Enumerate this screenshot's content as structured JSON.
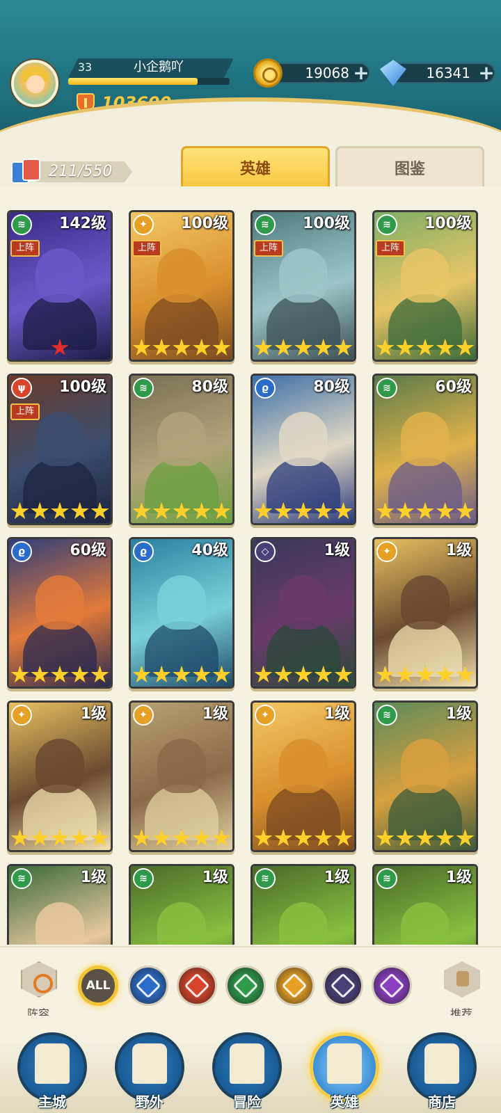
{
  "player": {
    "level": "33",
    "name": "小企鹅吖",
    "xp_fraction": 0.8,
    "power": "103600"
  },
  "resources": {
    "gold": "19068",
    "gems": "16341",
    "plus": "+"
  },
  "heroes_count": "211/550",
  "tabs": {
    "heroes": "英雄",
    "codex": "图鉴"
  },
  "deploy_label": "上阵",
  "element_colors": {
    "nature": "#2e9a4a",
    "light": "#e6a025",
    "fire": "#d8452a",
    "water": "#2a6cc8",
    "void": "#4b3f78",
    "arcane": "#8a3fc0"
  },
  "hero_cards": [
    {
      "element": "nature",
      "level": "142级",
      "deployed": true,
      "stars": 0,
      "red_star": true,
      "art": [
        "#3a2a86",
        "#6b58c8",
        "#1c1c44"
      ]
    },
    {
      "element": "light",
      "level": "100级",
      "deployed": true,
      "stars": 5,
      "red_star": false,
      "art": [
        "#f3c764",
        "#d9902e",
        "#7a4a20"
      ]
    },
    {
      "element": "nature",
      "level": "100级",
      "deployed": true,
      "stars": 5,
      "red_star": false,
      "art": [
        "#4d7a7e",
        "#9cc5c9",
        "#3b4f55"
      ]
    },
    {
      "element": "nature",
      "level": "100级",
      "deployed": true,
      "stars": 5,
      "red_star": false,
      "art": [
        "#7fae66",
        "#e8c567",
        "#3a6a3a"
      ]
    },
    {
      "element": "fire",
      "level": "100级",
      "deployed": true,
      "stars": 5,
      "red_star": false,
      "art": [
        "#6a3a2a",
        "#3b4d6e",
        "#1c2440"
      ]
    },
    {
      "element": "nature",
      "level": "80级",
      "deployed": false,
      "stars": 5,
      "red_star": false,
      "art": [
        "#7a6f55",
        "#b3a27a",
        "#6aa040"
      ]
    },
    {
      "element": "water",
      "level": "80级",
      "deployed": false,
      "stars": 5,
      "red_star": false,
      "art": [
        "#3d6fa8",
        "#e0d8c4",
        "#2a3a7a"
      ]
    },
    {
      "element": "nature",
      "level": "60级",
      "deployed": false,
      "stars": 5,
      "red_star": false,
      "art": [
        "#5a7a4a",
        "#e0b24a",
        "#6a5a8a"
      ]
    },
    {
      "element": "water",
      "level": "60级",
      "deployed": false,
      "stars": 5,
      "red_star": false,
      "art": [
        "#2f3d7a",
        "#e27a3a",
        "#2a2a50"
      ]
    },
    {
      "element": "water",
      "level": "40级",
      "deployed": false,
      "stars": 5,
      "red_star": false,
      "art": [
        "#2a7fa0",
        "#7ad0d8",
        "#1e4a6a"
      ]
    },
    {
      "element": "void",
      "level": "1级",
      "deployed": false,
      "stars": 5,
      "red_star": false,
      "art": [
        "#3a3a5a",
        "#6a3a6a",
        "#2a4a3a"
      ]
    },
    {
      "element": "light",
      "level": "1级",
      "deployed": false,
      "stars": 5,
      "red_star": false,
      "art": [
        "#e8c060",
        "#6a4a30",
        "#f0e0b0"
      ]
    },
    {
      "element": "light",
      "level": "1级",
      "deployed": false,
      "stars": 5,
      "red_star": false,
      "art": [
        "#e8c060",
        "#6a4a30",
        "#f0e0b0"
      ]
    },
    {
      "element": "light",
      "level": "1级",
      "deployed": false,
      "stars": 5,
      "red_star": false,
      "art": [
        "#b8a070",
        "#8a6a4a",
        "#e0d0a0"
      ]
    },
    {
      "element": "light",
      "level": "1级",
      "deployed": false,
      "stars": 5,
      "red_star": false,
      "art": [
        "#f3c764",
        "#d9902e",
        "#7a4a20"
      ]
    },
    {
      "element": "nature",
      "level": "1级",
      "deployed": false,
      "stars": 5,
      "red_star": false,
      "art": [
        "#5a8a5a",
        "#d8a040",
        "#3a5a3a"
      ]
    },
    {
      "element": "nature",
      "level": "1级",
      "deployed": false,
      "stars": 0,
      "red_star": false,
      "art": [
        "#3a6a3a",
        "#e8c8a0",
        "#2a4a2a"
      ]
    },
    {
      "element": "nature",
      "level": "1级",
      "deployed": false,
      "stars": 0,
      "red_star": false,
      "art": [
        "#4a6a2a",
        "#8ac040",
        "#2a3a1a"
      ]
    },
    {
      "element": "nature",
      "level": "1级",
      "deployed": false,
      "stars": 0,
      "red_star": false,
      "art": [
        "#4a6a2a",
        "#8ac040",
        "#2a3a1a"
      ]
    },
    {
      "element": "nature",
      "level": "1级",
      "deployed": false,
      "stars": 0,
      "red_star": false,
      "art": [
        "#4a6a2a",
        "#8ac040",
        "#2a3a1a"
      ]
    }
  ],
  "filters": {
    "lineup_label": "阵容",
    "recommend_label": "推荐",
    "all_label": "ALL",
    "elements": [
      {
        "name": "water",
        "color": "#2a6cc8"
      },
      {
        "name": "fire",
        "color": "#d8452a"
      },
      {
        "name": "nature",
        "color": "#2e9a4a"
      },
      {
        "name": "light",
        "color": "#e6a025"
      },
      {
        "name": "void",
        "color": "#4b3f78"
      },
      {
        "name": "arcane",
        "color": "#8a3fc0"
      }
    ]
  },
  "nav": [
    {
      "label": "主城",
      "active": false
    },
    {
      "label": "野外",
      "active": false
    },
    {
      "label": "冒险",
      "active": false
    },
    {
      "label": "英雄",
      "active": true
    },
    {
      "label": "商店",
      "active": false
    }
  ]
}
